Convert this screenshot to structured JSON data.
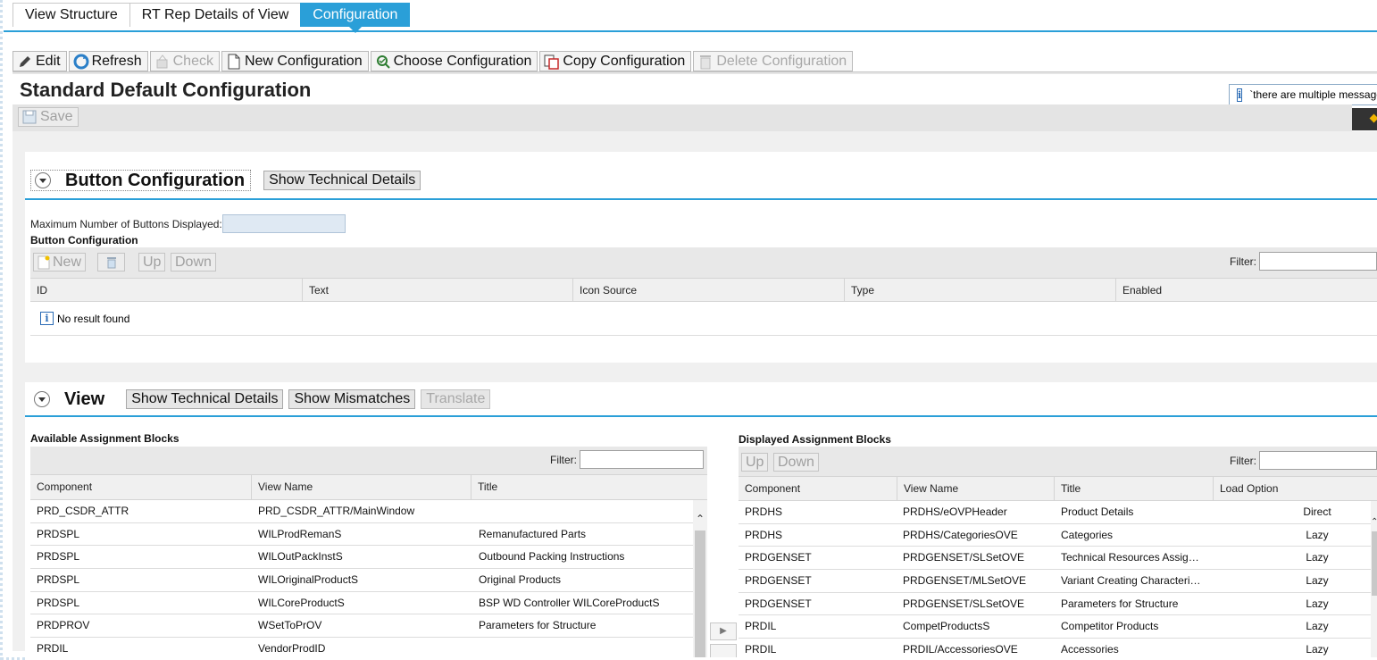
{
  "tabs": [
    "View Structure",
    "RT Rep Details of View",
    "Configuration"
  ],
  "toolbar": {
    "edit": "Edit",
    "refresh": "Refresh",
    "check": "Check",
    "new_configuration": "New Configuration",
    "choose_configuration": "Choose Configuration",
    "copy_configuration": "Copy Configuration",
    "delete_configuration": "Delete Configuration"
  },
  "page_title": "Standard Default Configuration",
  "message": "`there are multiple messages",
  "save_label": "Save",
  "button_config": {
    "title": "Button Configuration",
    "show_technical_details": "Show Technical Details",
    "max_buttons_label": "Maximum Number of Buttons Displayed:",
    "max_buttons_value": "",
    "table_title": "Button Configuration",
    "new_label": "New",
    "up_label": "Up",
    "down_label": "Down",
    "filter_label": "Filter:",
    "columns": [
      "ID",
      "Text",
      "Icon Source",
      "Type",
      "Enabled"
    ],
    "empty_text": "No result found"
  },
  "view": {
    "title": "View",
    "show_technical_details": "Show Technical Details",
    "show_mismatches": "Show Mismatches",
    "translate": "Translate",
    "available": {
      "title": "Available Assignment Blocks",
      "filter_label": "Filter:",
      "columns": [
        "Component",
        "View Name",
        "Title"
      ],
      "rows": [
        {
          "component": "PRD_CSDR_ATTR",
          "view_name": "PRD_CSDR_ATTR/MainWindow",
          "title": ""
        },
        {
          "component": "PRDSPL",
          "view_name": "WILProdRemanS",
          "title": "Remanufactured Parts"
        },
        {
          "component": "PRDSPL",
          "view_name": "WILOutPackInstS",
          "title": "Outbound Packing Instructions"
        },
        {
          "component": "PRDSPL",
          "view_name": "WILOriginalProductS",
          "title": "Original Products"
        },
        {
          "component": "PRDSPL",
          "view_name": "WILCoreProductS",
          "title": "BSP WD Controller WILCoreProductS"
        },
        {
          "component": "PRDPROV",
          "view_name": "WSetToPrOV",
          "title": "Parameters for Structure"
        },
        {
          "component": "PRDIL",
          "view_name": "VendorProdID",
          "title": ""
        }
      ]
    },
    "displayed": {
      "title": "Displayed Assignment Blocks",
      "up_label": "Up",
      "down_label": "Down",
      "filter_label": "Filter:",
      "columns": [
        "Component",
        "View Name",
        "Title",
        "Load Option"
      ],
      "rows": [
        {
          "component": "PRDHS",
          "view_name": "PRDHS/eOVPHeader",
          "title": "Product Details",
          "load": "Direct"
        },
        {
          "component": "PRDHS",
          "view_name": "PRDHS/CategoriesOVE",
          "title": "Categories",
          "load": "Lazy"
        },
        {
          "component": "PRDGENSET",
          "view_name": "PRDGENSET/SLSetOVE",
          "title": "Technical Resources Assig…",
          "load": "Lazy"
        },
        {
          "component": "PRDGENSET",
          "view_name": "PRDGENSET/MLSetOVE",
          "title": "Variant Creating Characteri…",
          "load": "Lazy"
        },
        {
          "component": "PRDGENSET",
          "view_name": "PRDGENSET/SLSetOVE",
          "title": "Parameters for Structure",
          "load": "Lazy"
        },
        {
          "component": "PRDIL",
          "view_name": "CompetProductsS",
          "title": "Competitor Products",
          "load": "Lazy"
        },
        {
          "component": "PRDIL",
          "view_name": "PRDIL/AccessoriesOVE",
          "title": "Accessories",
          "load": "Lazy"
        }
      ]
    }
  }
}
